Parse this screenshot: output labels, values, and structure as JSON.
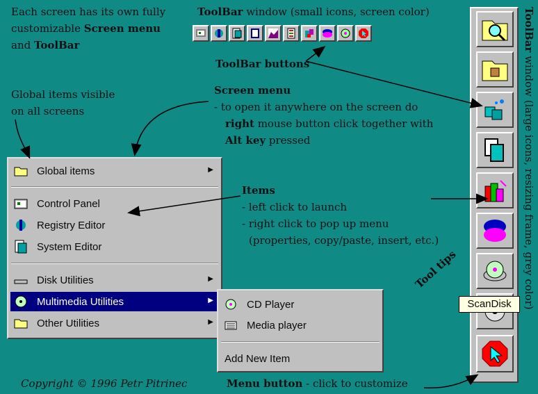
{
  "annotations": {
    "screen_each": [
      "Each screen has its own fully",
      "customizable ",
      "Screen menu",
      "and ",
      "ToolBar"
    ],
    "toolbar_window_title": "ToolBar",
    "toolbar_window_rest": " window (small icons, screen color)",
    "toolbar_buttons": "ToolBar buttons",
    "global_items_note_1": "Global items visible",
    "global_items_note_2": "on all screens",
    "screen_menu_title": "Screen menu",
    "screen_menu_l1": "- to open it anywhere on the screen do",
    "screen_menu_l2_bold": "right",
    "screen_menu_l2": " mouse button click together with",
    "screen_menu_l3_bold": "Alt key",
    "screen_menu_l3": " pressed",
    "items_title": "Items",
    "items_l1": "- left click to launch",
    "items_l2": "- right click to pop up menu",
    "items_l3": "(properties, copy/paste, insert, etc.)",
    "tool_tips": "Tool tips",
    "copyright": "Copyright © 1996  Petr Pitrinec",
    "menu_button_bold": "Menu button",
    "menu_button_rest": " - click to customize",
    "vertical_toolbar_bold": "ToolBar",
    "vertical_toolbar_rest": " window (large icons, resizing frame, grey color)"
  },
  "main_menu": {
    "items": [
      {
        "label": "Global items",
        "icon": "folder-icon",
        "submenu": true
      },
      {
        "label": "Control Panel",
        "icon": "control-panel-icon",
        "submenu": false
      },
      {
        "label": "Registry Editor",
        "icon": "registry-editor-icon",
        "submenu": false
      },
      {
        "label": "System Editor",
        "icon": "system-editor-icon",
        "submenu": false
      },
      {
        "label": "Disk Utilities",
        "icon": "disk-icon",
        "submenu": true
      },
      {
        "label": "Multimedia Utilities",
        "icon": "cd-icon",
        "submenu": true,
        "selected": true
      },
      {
        "label": "Other Utilities",
        "icon": "folder-icon",
        "submenu": true
      }
    ]
  },
  "sub_menu": {
    "items": [
      {
        "label": "CD Player",
        "icon": "cd-player-icon"
      },
      {
        "label": "Media player",
        "icon": "media-player-icon"
      },
      {
        "label": "Add New Item",
        "icon": ""
      }
    ]
  },
  "tooltip": "ScanDisk",
  "vertical_toolbar_icons": [
    "find-icon",
    "folder-tools-icon",
    "network-icon",
    "documents-icon",
    "chart-icon",
    "pie-chart-icon",
    "scandisk-icon",
    "cd-icon",
    "menu-arrow-icon"
  ],
  "small_toolbar_icons": [
    "control-panel-icon",
    "registry-editor-icon",
    "system-editor-icon",
    "notepad-icon",
    "chart-icon",
    "list-icon",
    "network-icon",
    "pie-chart-icon",
    "scandisk-icon",
    "menu-arrow-icon"
  ],
  "colors": {
    "background": "#0f8a84",
    "menu_select": "#000080",
    "menu_bg": "#c0c0c0",
    "tooltip_bg": "#ffffe1"
  }
}
